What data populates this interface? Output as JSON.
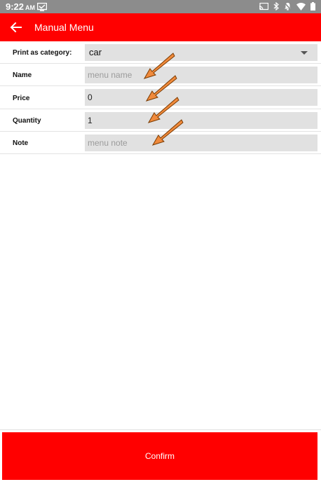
{
  "status_bar": {
    "time": "9:22",
    "ampm": "AM"
  },
  "app_bar": {
    "title": "Manual Menu",
    "back_icon": "arrow-left-icon"
  },
  "form": {
    "category": {
      "label": "Print as category:",
      "value": "car"
    },
    "name": {
      "label": "Name",
      "value": "",
      "placeholder": "menu name"
    },
    "price": {
      "label": "Price",
      "value": "0"
    },
    "quantity": {
      "label": "Quantity",
      "value": "1"
    },
    "note": {
      "label": "Note",
      "value": "",
      "placeholder": "menu note"
    }
  },
  "confirm_label": "Confirm",
  "colors": {
    "accent": "#ff0000",
    "status_bar": "#8c8c8c",
    "field_bg": "#e1e1e1",
    "annotation_arrow": "#f08a3c"
  }
}
